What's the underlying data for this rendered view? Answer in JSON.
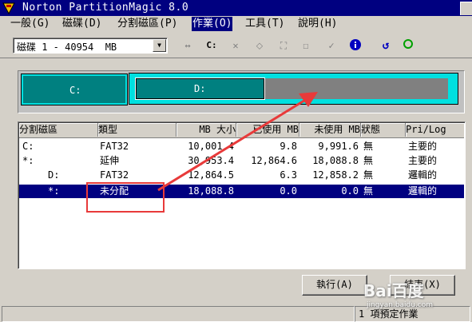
{
  "window": {
    "title": "Norton PartitionMagic 8.0"
  },
  "menu": [
    {
      "label": "一般(G)"
    },
    {
      "label": "磁碟(D)"
    },
    {
      "label": "分割磁區(P)"
    },
    {
      "label": "作業(O)"
    },
    {
      "label": "工具(T)"
    },
    {
      "label": "說明(H)"
    }
  ],
  "toolbar": {
    "disk_select": "磁碟 1 - 40954  MB",
    "drive_letter_label": "C:",
    "colors": {
      "info": "#0000c0",
      "undo": "#0000c0",
      "ok": "#00a000"
    }
  },
  "map": {
    "c_label": "C:",
    "d_label": "D:",
    "colors": {
      "primary": "#008080",
      "extended": "#00e0e0",
      "unallocated": "#808080"
    }
  },
  "table": {
    "headers": [
      "分割磁區",
      "類型",
      "MB 大小",
      "已使用 MB",
      "未使用 MB",
      "狀態",
      "Pri/Log"
    ],
    "rows": [
      {
        "partition": "C:",
        "type": "FAT32",
        "size": "10,001.4",
        "used": "9.8",
        "unused": "9,991.6",
        "status": "無",
        "prilog": "主要的"
      },
      {
        "partition": "*:",
        "type": "延伸",
        "size": "30,953.4",
        "used": "12,864.6",
        "unused": "18,088.8",
        "status": "無",
        "prilog": "主要的"
      },
      {
        "partition": "D:",
        "type": "FAT32",
        "size": "12,864.5",
        "used": "6.3",
        "unused": "12,858.2",
        "status": "無",
        "prilog": "邏輯的"
      },
      {
        "partition": "*:",
        "type": "未分配",
        "size": "18,088.8",
        "used": "0.0",
        "unused": "0.0",
        "status": "無",
        "prilog": "邏輯的"
      }
    ]
  },
  "buttons": {
    "apply": "執行(A)",
    "close": "結束(X)"
  },
  "status": {
    "pending": "1 項預定作業"
  },
  "watermark": {
    "main": "Bai百度",
    "sub": "jingyan.baidu.com"
  },
  "annotation_color": "#e83a3a"
}
